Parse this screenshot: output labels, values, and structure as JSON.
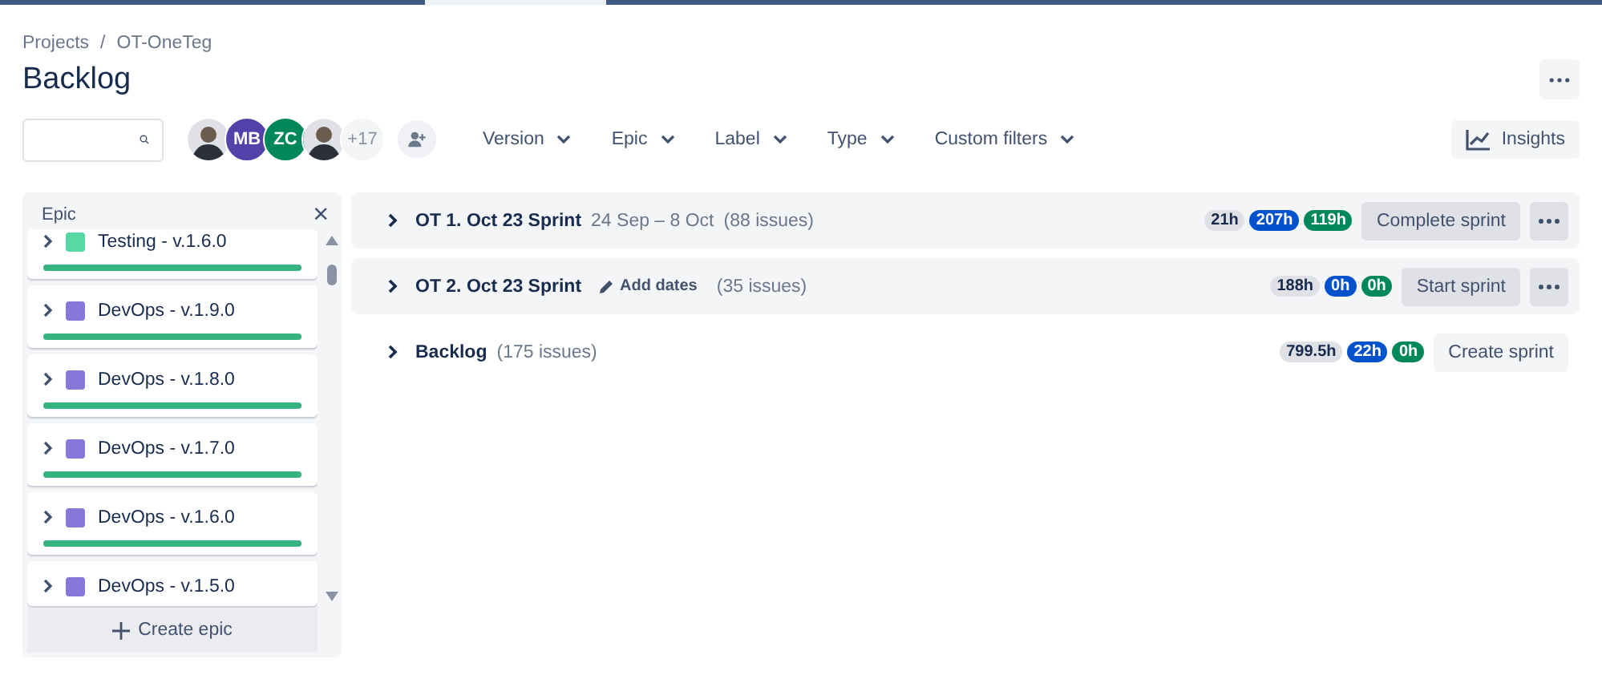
{
  "breadcrumbs": [
    "Projects",
    "/",
    "OT-OneTeg"
  ],
  "title": "Backlog",
  "avatars": [
    {
      "kind": "photo"
    },
    {
      "kind": "initials",
      "text": "MB",
      "color": "#5243aa"
    },
    {
      "kind": "initials",
      "text": "ZC",
      "color": "#00875a"
    },
    {
      "kind": "photo"
    }
  ],
  "more_people": "+17",
  "filters": [
    "Version",
    "Epic",
    "Label",
    "Type",
    "Custom filters"
  ],
  "insights_button": "Insights",
  "epic_panel": {
    "title": "Epic",
    "close": "×",
    "create_button": "Create epic",
    "items": [
      {
        "name": "Testing - v.1.6.0",
        "color": "#57d9a3",
        "level": 1
      },
      {
        "name": "DevOps - v.1.9.0",
        "color": "#8777d9",
        "level": 1
      },
      {
        "name": "DevOps - v.1.8.0",
        "color": "#8777d9",
        "level": 1
      },
      {
        "name": "DevOps - v.1.7.0",
        "color": "#8777d9",
        "level": 1
      },
      {
        "name": "DevOps - v.1.6.0",
        "color": "#8777d9",
        "level": 1
      },
      {
        "name": "DevOps - v.1.5.0",
        "color": "#8777d9"
      }
    ]
  },
  "sprints": [
    {
      "kind": "sprint",
      "name": "OT 1. Oct 23 Sprint",
      "dates": "24 Sep – 8 Oct",
      "count": "(88 issues)",
      "estimates": [
        "21h",
        "207h",
        "119h"
      ],
      "button": "Complete sprint",
      "menu": true
    },
    {
      "kind": "sprint",
      "name": "OT 2. Oct 23 Sprint",
      "add_dates": "Add dates",
      "count": "(35 issues)",
      "estimates": [
        "188h",
        "0h",
        "0h"
      ],
      "button": "Start sprint",
      "menu": true
    },
    {
      "kind": "backlog",
      "name": "Backlog",
      "count": "(175 issues)",
      "estimates": [
        "799.5h",
        "22h",
        "0h"
      ],
      "button": "Create sprint",
      "menu": false
    }
  ]
}
